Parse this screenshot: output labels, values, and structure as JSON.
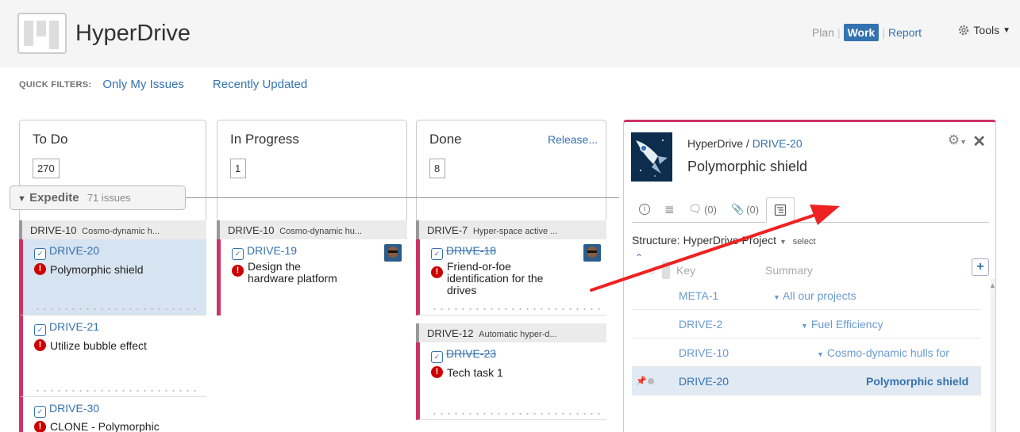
{
  "header": {
    "app_title": "HyperDrive",
    "nav": {
      "plan": "Plan",
      "work": "Work",
      "report": "Report",
      "tools": "Tools"
    }
  },
  "filters": {
    "label": "QUICK FILTERS:",
    "items": [
      "Only My Issues",
      "Recently Updated"
    ]
  },
  "columns": [
    {
      "name": "To Do",
      "count": "270"
    },
    {
      "name": "In Progress",
      "count": "1"
    },
    {
      "name": "Done",
      "count": "8",
      "release": "Release..."
    }
  ],
  "swimlane": {
    "name": "Expedite",
    "count": "71 issues"
  },
  "lanes": {
    "todo": {
      "parent_key": "DRIVE-10",
      "parent_summary": "Cosmo-dynamic h...",
      "cards": [
        {
          "key": "DRIVE-20",
          "summary": "Polymorphic shield"
        },
        {
          "key": "DRIVE-21",
          "summary": "Utilize bubble effect"
        },
        {
          "key": "DRIVE-30",
          "summary": "CLONE - Polymorphic"
        }
      ]
    },
    "inprogress": {
      "parent_key": "DRIVE-10",
      "parent_summary": "Cosmo-dynamic hu...",
      "cards": [
        {
          "key": "DRIVE-19",
          "summary_line1": "Design the",
          "summary_line2": "hardware platform"
        }
      ]
    },
    "done": {
      "parent_key": "DRIVE-7",
      "parent_summary": "Hyper-space active ...",
      "cards": [
        {
          "key": "DRIVE-18",
          "summary_line1": "Friend-or-foe",
          "summary_line2": "identification for the",
          "summary_line3": "drives"
        }
      ],
      "parent2_key": "DRIVE-12",
      "parent2_summary": "Automatic hyper-d...",
      "cards2": [
        {
          "key": "DRIVE-23",
          "summary": "Tech task 1"
        }
      ]
    }
  },
  "detail": {
    "project": "HyperDrive",
    "separator": "/",
    "issue_key": "DRIVE-20",
    "title": "Polymorphic shield",
    "tabs": {
      "comments": "(0)",
      "attachments": "(0)"
    },
    "structure_label": "Structure: HyperDrive Project",
    "structure_select": "select",
    "grid": {
      "col_key": "Key",
      "col_summary": "Summary",
      "rows": [
        {
          "key": "META-1",
          "summary": "All our projects"
        },
        {
          "key": "DRIVE-2",
          "summary": "Fuel Efficiency"
        },
        {
          "key": "DRIVE-10",
          "summary": "Cosmo-dynamic hulls for"
        },
        {
          "key": "DRIVE-20",
          "summary": "Polymorphic shield"
        }
      ]
    }
  },
  "colors": {
    "accent": "#3572b0",
    "priority": "#cc0000",
    "card_edge": "#cc3366",
    "arrow": "#ee2222"
  }
}
